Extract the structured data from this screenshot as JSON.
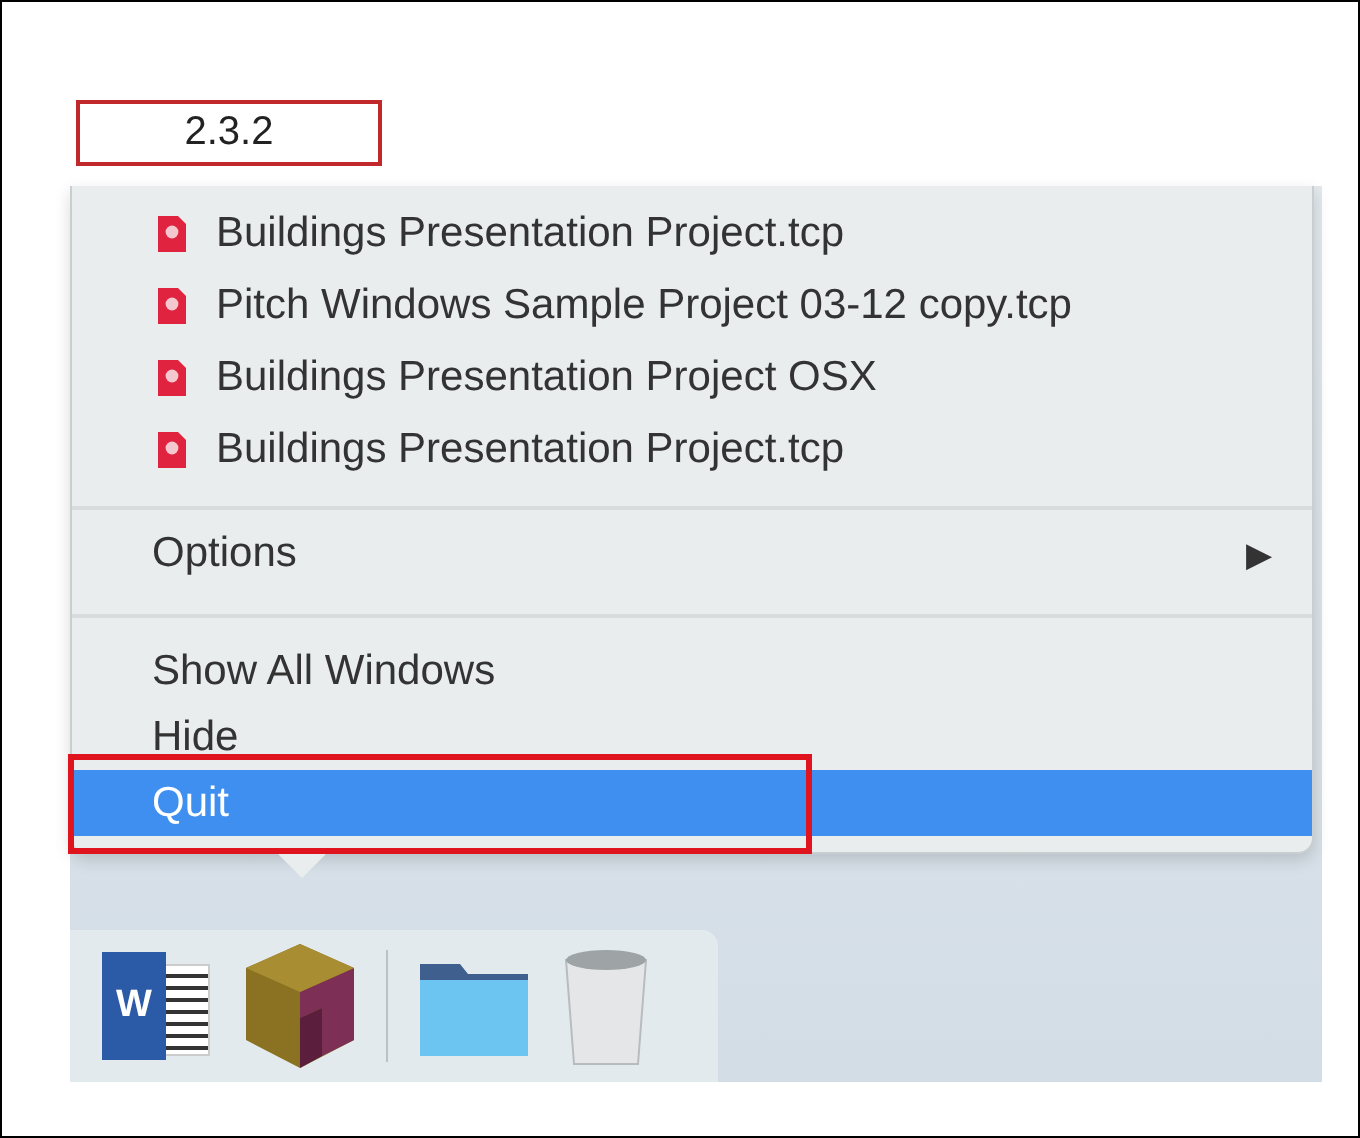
{
  "label": "2.3.2",
  "recent_files": [
    {
      "name": "Buildings Presentation Project.tcp"
    },
    {
      "name": "Pitch Windows Sample Project 03-12 copy.tcp"
    },
    {
      "name": "Buildings Presentation Project OSX"
    },
    {
      "name": "Buildings Presentation Project.tcp"
    }
  ],
  "options": {
    "label": "Options",
    "arrow": "▶"
  },
  "actions": [
    {
      "label": "Show All Windows",
      "selected": false
    },
    {
      "label": "Hide",
      "selected": false
    },
    {
      "label": "Quit",
      "selected": true
    }
  ],
  "dock": [
    {
      "kind": "word",
      "glyph": "W"
    },
    {
      "kind": "app"
    },
    {
      "kind": "divider"
    },
    {
      "kind": "folder"
    },
    {
      "kind": "trash"
    }
  ]
}
